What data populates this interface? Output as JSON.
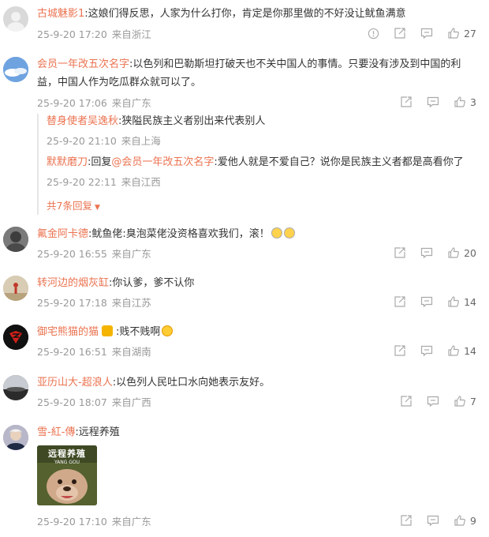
{
  "comments": [
    {
      "user": "古城魅影1",
      "text": ":这娘们得反思，人家为什么打你，肯定是你那里做的不好没让鱿鱼满意",
      "time": "25-9-20 17:20",
      "location": "来自浙江",
      "likes": "27",
      "avatar_color": "#d9d9d9"
    },
    {
      "user": "会员一年改五次名字",
      "text_line1": ":以色列和巴勒斯坦打破天也不关中国人的事情。只要没有涉及到中国的利",
      "text_line2": "益，中国人作为吃瓜群众就可以了。",
      "time": "25-9-20 17:06",
      "location": "来自广东",
      "likes": "3",
      "avatar_color": "#5b8fd6",
      "replies": [
        {
          "user": "替身使者吴逸秋",
          "text": ":狭隘民族主义者别出来代表别人",
          "time": "25-9-20 21:10",
          "location": "来自上海"
        },
        {
          "user": "默默磨刀",
          "prefix": ":回复",
          "mention": "@会员一年改五次名字",
          "text": ":爱他人就是不爱自己？说你是民族主义者都是高看你了",
          "time": "25-9-20 22:11",
          "location": "来自江西"
        }
      ],
      "more_replies": "共7条回复"
    },
    {
      "user": "氟金阿卡德",
      "text": ":鱿鱼佬:臭泡菜佬没资格喜欢我们，滚！",
      "time": "25-9-20 16:55",
      "location": "来自广东",
      "likes": "20",
      "avatar_color": "#6e6e6e"
    },
    {
      "user": "转河边的烟灰缸",
      "text": ":你认爹，爹不认你",
      "time": "25-9-20 17:18",
      "location": "来自江苏",
      "likes": "14",
      "avatar_color": "#c9b89a"
    },
    {
      "user": "御宅熊猫的猫",
      "text": ":贱不贱啊",
      "time": "25-9-20 16:51",
      "location": "来自湖南",
      "likes": "14",
      "avatar_color": "#111111"
    },
    {
      "user": "亚历山大-超浪人",
      "text": ":以色列人民吐口水向她表示友好。",
      "time": "25-9-20 18:07",
      "location": "来自广西",
      "likes": "7",
      "avatar_color": "#3b3b3b"
    },
    {
      "user": "雪-紅-傳",
      "text": ":远程养殖",
      "time": "25-9-20 17:10",
      "location": "来自广东",
      "likes": "9",
      "avatar_color": "#8a8aa0",
      "image_caption": "远程养殖",
      "image_sub": "YANG GOU"
    }
  ],
  "colors": {
    "username": "#eb7350",
    "meta": "#999999",
    "text": "#333333"
  },
  "icons": [
    "report-icon",
    "share-icon",
    "comment-icon",
    "like-icon"
  ]
}
